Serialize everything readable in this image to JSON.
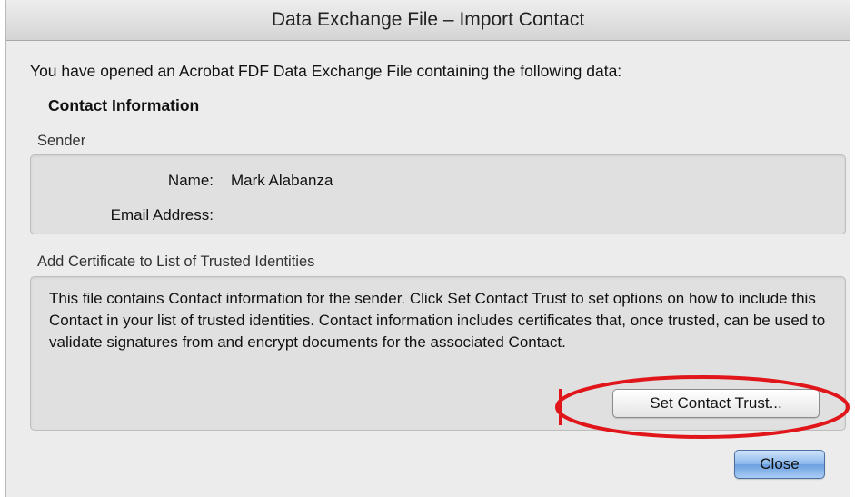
{
  "window": {
    "title": "Data Exchange File – Import Contact"
  },
  "intro_text": "You have opened an Acrobat FDF Data Exchange File containing the following data:",
  "section_heading": "Contact Information",
  "sender": {
    "group_label": "Sender",
    "name_label": "Name:",
    "name_value": "Mark Alabanza",
    "email_label": "Email Address:",
    "email_value": ""
  },
  "certificate": {
    "group_label": "Add Certificate to List of Trusted Identities",
    "description": "This file contains Contact information for the sender. Click Set Contact Trust to set options on how to include this Contact in your list of trusted identities. Contact information includes certificates that, once trusted, can be used to validate signatures from and encrypt documents for the associated Contact.",
    "set_trust_button": "Set Contact Trust..."
  },
  "close_button": "Close",
  "colors": {
    "annotation_ellipse": "#e0161b",
    "default_button": "#6a9fe0"
  }
}
